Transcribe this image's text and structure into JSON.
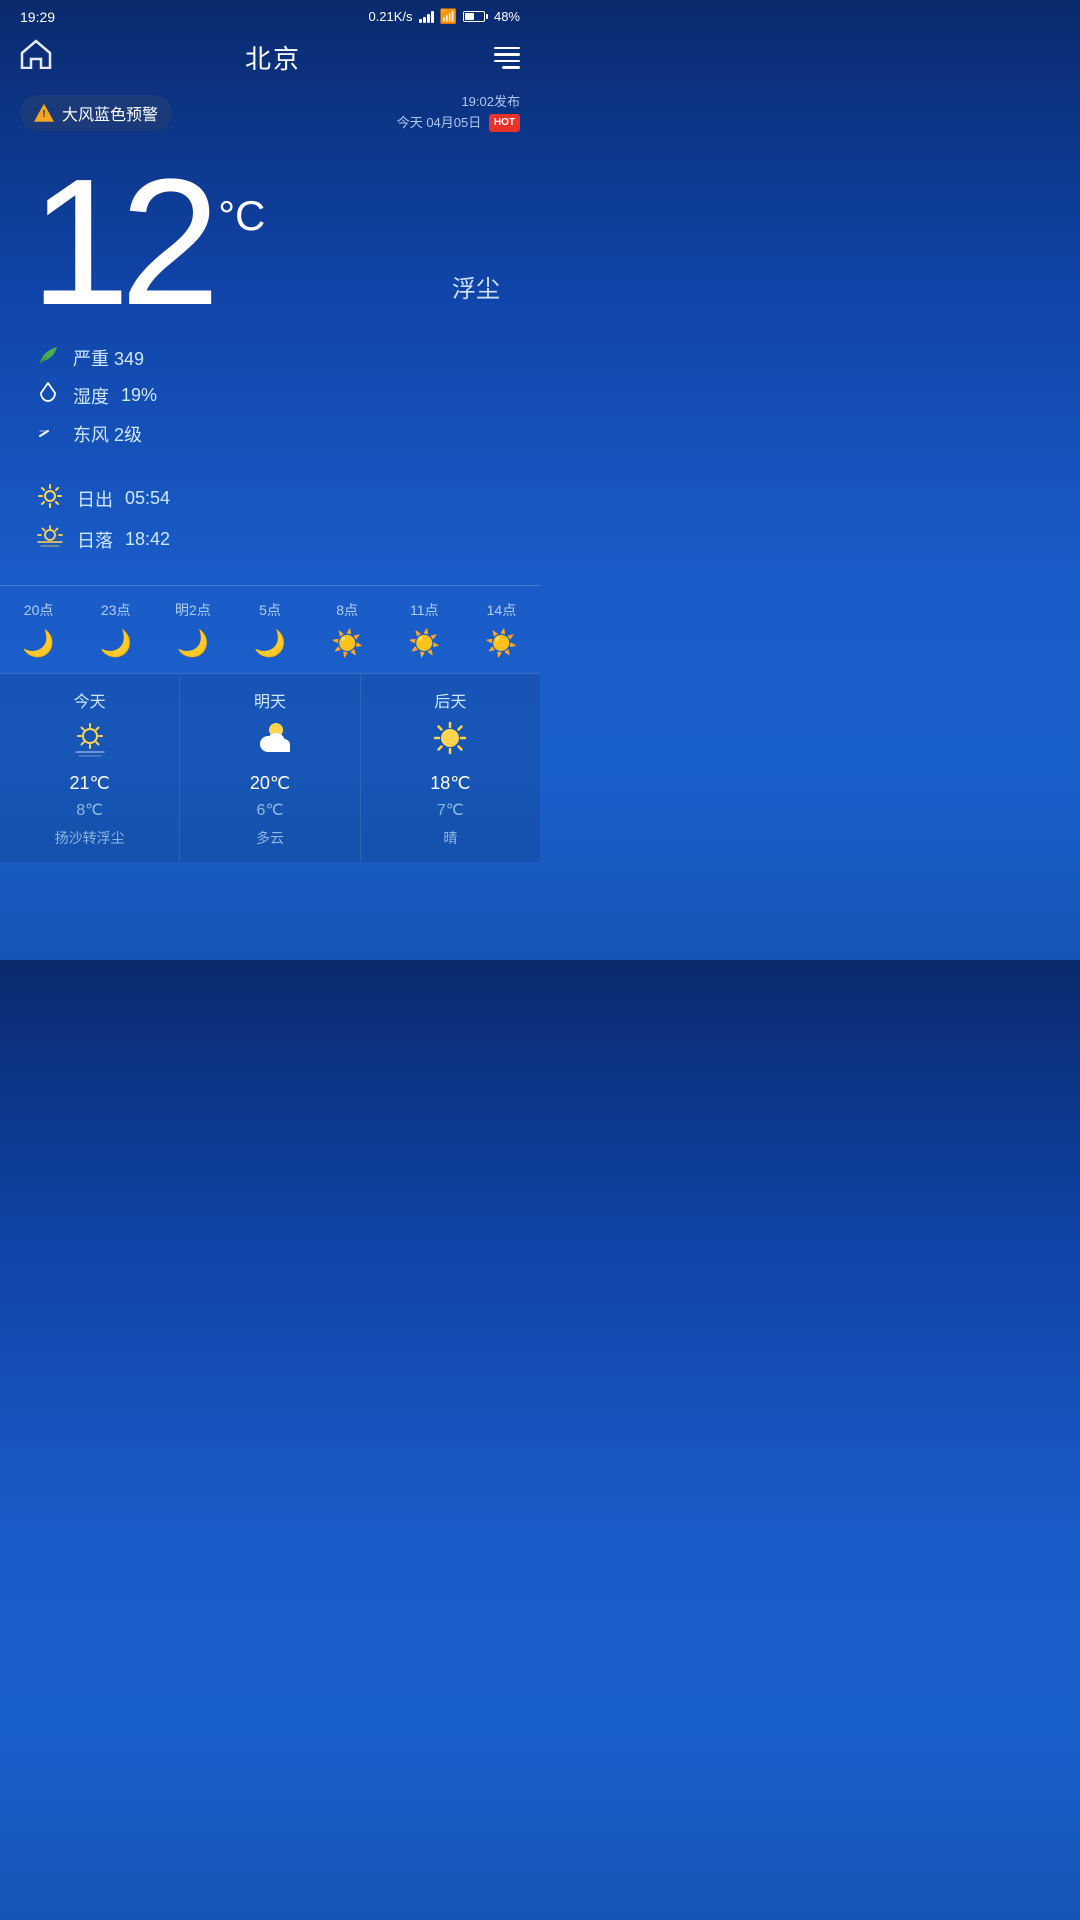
{
  "statusBar": {
    "time": "19:29",
    "network": "0.21K/s",
    "battery": "48%"
  },
  "header": {
    "cityName": "北京",
    "homeIconLabel": "home",
    "menuIconLabel": "menu"
  },
  "warning": {
    "text": "大风蓝色预警",
    "publishTime": "19:02发布",
    "dateLabel": "今天 04月05日",
    "hotBadge": "HOT"
  },
  "weather": {
    "temperature": "12",
    "unit": "°C",
    "description": "浮尘",
    "aqi": {
      "level": "严重",
      "value": "349",
      "iconLabel": "leaf-icon"
    },
    "humidity": "19%",
    "wind": "东风 2级",
    "sunrise": "05:54",
    "sunset": "18:42",
    "sunriseLabel": "日出",
    "sunsetLabel": "日落",
    "humidityLabel": "湿度",
    "windLabel": "东风"
  },
  "hourly": [
    {
      "time": "20点",
      "icon": "🌙",
      "type": "moon"
    },
    {
      "time": "23点",
      "icon": "🌙",
      "type": "moon"
    },
    {
      "time": "明2点",
      "icon": "🌙",
      "type": "moon"
    },
    {
      "time": "5点",
      "icon": "🌙",
      "type": "moon"
    },
    {
      "time": "8点",
      "icon": "☀️",
      "type": "sun"
    },
    {
      "time": "11点",
      "icon": "☀️",
      "type": "sun"
    },
    {
      "time": "14点",
      "icon": "☀️",
      "type": "sun"
    }
  ],
  "daily": [
    {
      "day": "今天",
      "icon": "🌫",
      "iconType": "dust-sun",
      "high": "21℃",
      "low": "8℃",
      "desc": "扬沙转浮尘"
    },
    {
      "day": "明天",
      "icon": "⛅",
      "iconType": "partly-cloudy",
      "high": "20℃",
      "low": "6℃",
      "desc": "多云"
    },
    {
      "day": "后天",
      "icon": "☀️",
      "iconType": "sunny",
      "high": "18℃",
      "low": "7℃",
      "desc": "晴"
    }
  ]
}
